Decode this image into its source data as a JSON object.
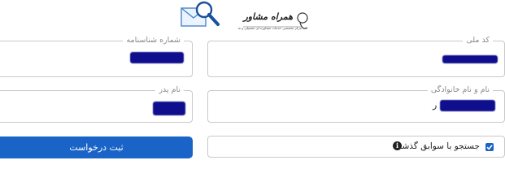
{
  "header": {
    "brand_title": "همراه مشاور",
    "brand_subtitle": "مرکز تخصصی خدمات مشاوره ای تحصیلی و شغلی کشور",
    "envelope_icon": "envelope-search-icon",
    "brand_icon": "brand-logo-icon"
  },
  "form": {
    "national_code": {
      "label": "کد ملی",
      "value": ""
    },
    "id_number": {
      "label": "شماره شناسنامه",
      "value": ""
    },
    "full_name": {
      "label": "نام و نام خانوادگی",
      "value": "ر"
    },
    "father_name": {
      "label": "نام پدر",
      "value": ""
    },
    "history_checkbox": {
      "label": "جستجو با سوابق گذشته",
      "checked": true
    },
    "info_icon": "i",
    "submit_label": "ثبت درخواست"
  },
  "colors": {
    "accent": "#1a63c7",
    "redaction": "#0f0f8e",
    "border": "#c9c9c9",
    "label": "#888888"
  }
}
